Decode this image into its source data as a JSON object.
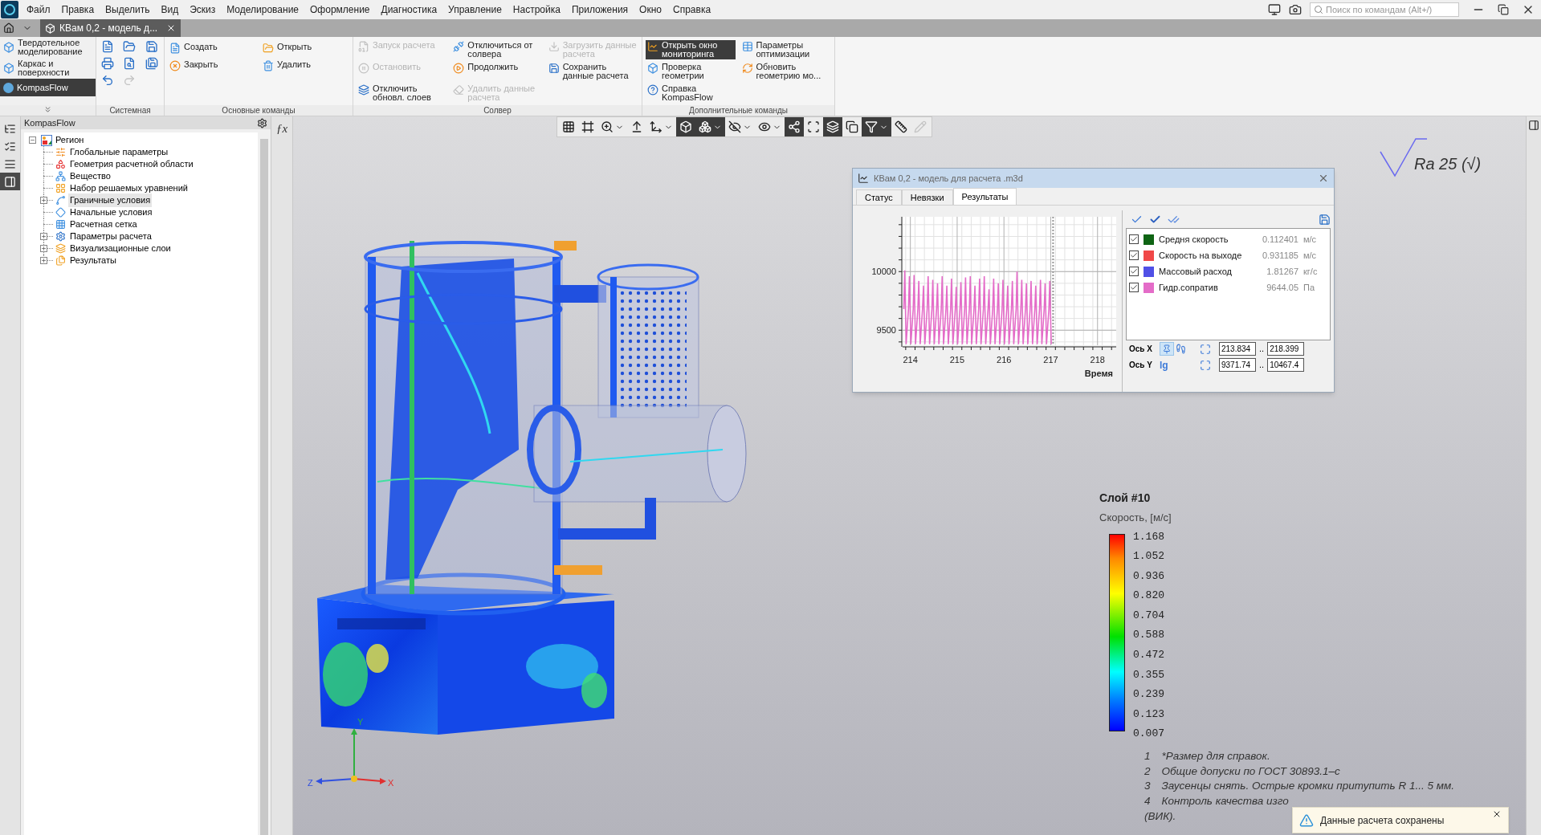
{
  "menu": [
    "Файл",
    "Правка",
    "Выделить",
    "Вид",
    "Эскиз",
    "Моделирование",
    "Оформление",
    "Диагностика",
    "Управление",
    "Настройка",
    "Приложения",
    "Окно",
    "Справка"
  ],
  "search": {
    "placeholder": "Поиск по командам (Alt+/)"
  },
  "document_tab": {
    "title": "КВам 0,2 - модель д..."
  },
  "modes": [
    {
      "label": "Твердотельное моделирование",
      "selected": false
    },
    {
      "label": "Каркас и поверхности",
      "selected": false
    },
    {
      "label": "KompasFlow",
      "selected": true
    }
  ],
  "ribbon": {
    "system": {
      "title": "Системная",
      "tools": [
        {
          "kind": "new",
          "disabled": false
        },
        {
          "kind": "open",
          "disabled": false
        },
        {
          "kind": "save",
          "disabled": false
        },
        {
          "kind": "print",
          "disabled": false
        },
        {
          "kind": "preview",
          "disabled": false
        },
        {
          "kind": "save_as",
          "disabled": false
        },
        {
          "kind": "undo",
          "disabled": false
        },
        {
          "kind": "redo",
          "disabled": true
        }
      ]
    },
    "main": {
      "title": "Основные команды",
      "commands": [
        {
          "label": "Создать"
        },
        {
          "label": "Закрыть"
        },
        {
          "label": "Открыть"
        },
        {
          "label": "Удалить"
        }
      ]
    },
    "solver": {
      "title": "Солвер",
      "commands": [
        {
          "label": "Запуск расчета",
          "disabled": true
        },
        {
          "label": "Остановить",
          "disabled": true
        },
        {
          "label": "Отключить обновл. слоев",
          "disabled": false
        },
        {
          "label": "Отключиться от солвера",
          "disabled": false
        },
        {
          "label": "Продолжить",
          "disabled": false
        },
        {
          "label": "Удалить данные расчета",
          "disabled": true
        },
        {
          "label": "Загрузить данные расчета",
          "disabled": true
        },
        {
          "label": "Сохранить данные расчета",
          "disabled": false
        }
      ]
    },
    "extra": {
      "title": "Дополнительные команды",
      "commands": [
        {
          "label": "Открыть окно мониторинга",
          "selected": true
        },
        {
          "label": "Проверка геометрии",
          "selected": false
        },
        {
          "label": "Справка KompasFlow",
          "selected": false
        },
        {
          "label": "Параметры оптимизации",
          "selected": false
        },
        {
          "label": "Обновить геометрию мо...",
          "selected": false
        }
      ]
    }
  },
  "left_strip": [
    {
      "selected": false
    },
    {
      "selected": false
    },
    {
      "selected": false
    },
    {
      "selected": true
    }
  ],
  "tree": {
    "title": "KompasFlow",
    "root": {
      "label": "Регион",
      "expanded": true,
      "children": [
        {
          "label": "Глобальные параметры",
          "selected": false
        },
        {
          "label": "Геометрия расчетной области",
          "selected": false
        },
        {
          "label": "Вещество",
          "selected": false
        },
        {
          "label": "Набор решаемых уравнений",
          "selected": false
        },
        {
          "label": "Граничные условия",
          "selected": true,
          "expanded": false
        },
        {
          "label": "Начальные условия",
          "selected": false
        },
        {
          "label": "Расчетная сетка",
          "selected": false
        },
        {
          "label": "Параметры расчета",
          "selected": false,
          "expanded": false
        },
        {
          "label": "Визуализационные слои",
          "selected": false,
          "expanded": false
        },
        {
          "label": "Результаты",
          "selected": false,
          "expanded": false
        }
      ]
    }
  },
  "view_toolbar": [
    {
      "dropdown": false,
      "active": false,
      "disabled": false
    },
    {
      "dropdown": false,
      "active": false,
      "disabled": false
    },
    {
      "dropdown": true,
      "active": false,
      "disabled": false
    },
    {
      "dropdown": false,
      "active": false,
      "disabled": false
    },
    {
      "dropdown": true,
      "active": false,
      "disabled": false
    },
    {
      "dropdown": false,
      "active": true,
      "disabled": false
    },
    {
      "dropdown": true,
      "active": true,
      "disabled": false
    },
    {
      "dropdown": true,
      "active": false,
      "disabled": false
    },
    {
      "dropdown": true,
      "active": false,
      "disabled": false
    },
    {
      "dropdown": false,
      "active": true,
      "disabled": false
    },
    {
      "dropdown": false,
      "active": false,
      "disabled": false
    },
    {
      "dropdown": false,
      "active": true,
      "disabled": false
    },
    {
      "dropdown": false,
      "active": false,
      "disabled": false
    },
    {
      "dropdown": true,
      "active": true,
      "disabled": false
    },
    {
      "dropdown": false,
      "active": false,
      "disabled": false
    },
    {
      "dropdown": false,
      "active": false,
      "disabled": true
    }
  ],
  "monitor": {
    "title": "КВам 0,2 - модель для расчета .m3d",
    "tabs": [
      {
        "label": "Статус",
        "selected": false
      },
      {
        "label": "Невязки",
        "selected": false
      },
      {
        "label": "Результаты",
        "selected": true
      }
    ],
    "chart_data": {
      "type": "line",
      "grid": true,
      "ref_lines": [
        {
          "axis": "x",
          "value": 217.05
        }
      ],
      "xlabel": "Время",
      "xlim": [
        213.834,
        218.399
      ],
      "ylim": [
        9371.74,
        10467.4
      ],
      "xticks": [
        214,
        215,
        216,
        217,
        218
      ],
      "yticks": [
        9500,
        10000
      ],
      "x": [
        213.86,
        213.88,
        213.91,
        213.96,
        213.98,
        214.01,
        214.06,
        214.08,
        214.11,
        214.16,
        214.18,
        214.21,
        214.26,
        214.28,
        214.31,
        214.36,
        214.38,
        214.41,
        214.46,
        214.48,
        214.51,
        214.56,
        214.58,
        214.61,
        214.66,
        214.68,
        214.71,
        214.76,
        214.78,
        214.81,
        214.86,
        214.88,
        214.91,
        214.96,
        214.98,
        215.01,
        215.06,
        215.08,
        215.11,
        215.16,
        215.18,
        215.21,
        215.26,
        215.28,
        215.31,
        215.36,
        215.38,
        215.41,
        215.46,
        215.48,
        215.51,
        215.56,
        215.58,
        215.61,
        215.66,
        215.68,
        215.71,
        215.76,
        215.78,
        215.81,
        215.86,
        215.88,
        215.91,
        215.96,
        215.98,
        216.01,
        216.06,
        216.08,
        216.11,
        216.16,
        216.18,
        216.21,
        216.26,
        216.28,
        216.31,
        216.36,
        216.38,
        216.41,
        216.46,
        216.48,
        216.51,
        216.56,
        216.58,
        216.61,
        216.66,
        216.68,
        216.71,
        216.76,
        216.78,
        216.81,
        216.86,
        216.88,
        216.91,
        216.96,
        216.98,
        217.01
      ],
      "series": [
        {
          "color": "#e46cc8",
          "values": [
            9680,
            10010,
            9380,
            9680,
            9960,
            9380,
            9680,
            9970,
            9380,
            9680,
            9920,
            9380,
            9680,
            9880,
            9380,
            9680,
            9960,
            9380,
            9680,
            9930,
            9380,
            9680,
            9900,
            9380,
            9680,
            9960,
            9380,
            9680,
            9880,
            9380,
            9680,
            9940,
            9380,
            9680,
            9870,
            9380,
            9680,
            9910,
            9380,
            9680,
            9950,
            9380,
            9680,
            9960,
            9380,
            9680,
            9880,
            9380,
            9680,
            9940,
            9380,
            9680,
            9960,
            9380,
            9680,
            9850,
            9380,
            9680,
            9940,
            9380,
            9680,
            9900,
            9380,
            9680,
            9930,
            9380,
            9680,
            9880,
            9380,
            9680,
            9920,
            9380,
            9680,
            10000,
            9380,
            9680,
            9930,
            9380,
            9680,
            9900,
            9380,
            9680,
            9920,
            9380,
            9680,
            9880,
            9380,
            9680,
            9930,
            9380,
            9680,
            9900,
            9380,
            9680,
            9920,
            9380
          ]
        }
      ]
    },
    "series_list": [
      {
        "name": "Средня скорость",
        "value": "0.112401",
        "unit": "м/с",
        "checked": true,
        "color": "#0f6414"
      },
      {
        "name": "Скорость на выходе",
        "value": "0.931185",
        "unit": "м/с",
        "checked": true,
        "color": "#f04848"
      },
      {
        "name": "Массовый расход",
        "value": "1.81267",
        "unit": "кг/с",
        "checked": true,
        "color": "#5050e6"
      },
      {
        "name": "Гидр.сопратив",
        "value": "9644.05",
        "unit": "Па",
        "checked": true,
        "color": "#e46cc8"
      }
    ],
    "axes": [
      {
        "label": "Ось X",
        "pinned": true,
        "min": "213.834",
        "separator": "..",
        "max": "218.399"
      },
      {
        "label": "Ось Y",
        "scale_label": "lg",
        "min": "9371.74",
        "separator": "..",
        "max": "10467.4"
      }
    ]
  },
  "formula_button": "ƒx",
  "roughness": "Ra 25 (√)",
  "legend": {
    "title": "Слой #10",
    "subtitle": "Скорость, [м/с]",
    "ticks": [
      "1.168",
      "1.052",
      "0.936",
      "0.820",
      "0.704",
      "0.588",
      "0.472",
      "0.355",
      "0.239",
      "0.123",
      "0.007"
    ]
  },
  "notes": [
    {
      "number": "1",
      "text": "*Размер для справок."
    },
    {
      "number": "2",
      "text": "Общие допуски по ГОСТ 30893.1–с"
    },
    {
      "number": "3",
      "text": "Заусенцы снять. Острые кромки притупить R 1... 5 мм."
    },
    {
      "number": "4",
      "text": "Контроль качества изго"
    }
  ],
  "notes_tail": "(ВИК).",
  "axis_labels": {
    "y": "Y",
    "z": "Z",
    "x": "X"
  },
  "toast": {
    "text": "Данные расчета сохранены"
  }
}
